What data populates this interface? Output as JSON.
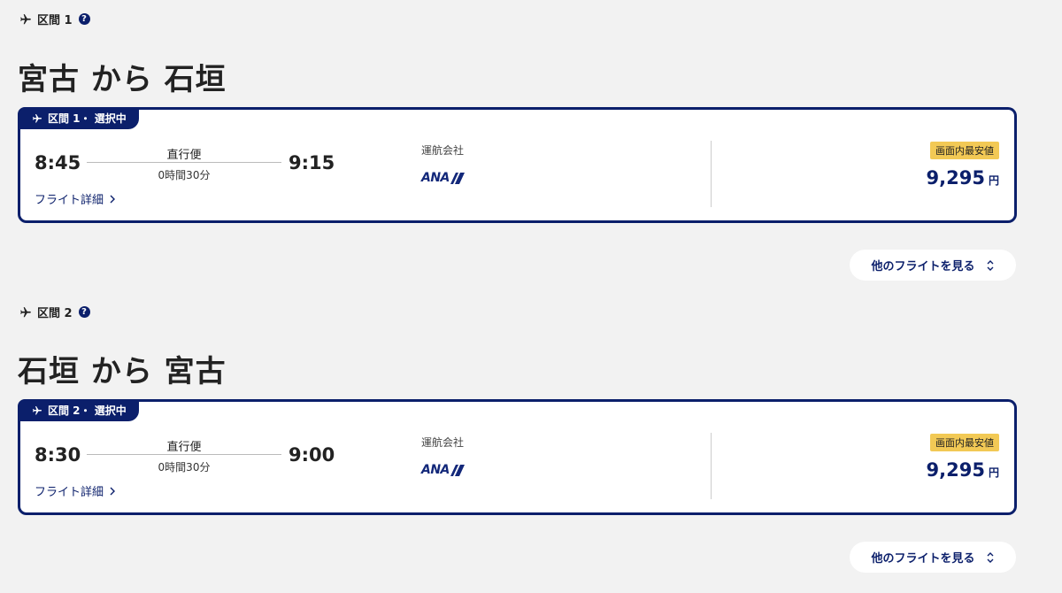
{
  "segments": [
    {
      "label": "区間 1",
      "route_title": "宮古 から 石垣",
      "card": {
        "tab_label": "区間 1・ 選択中",
        "departure_time": "8:45",
        "arrival_time": "9:15",
        "flight_type": "直行便",
        "duration": "0時間30分",
        "details_link": "フライト詳細",
        "operator_label": "運航会社",
        "operator_name": "ANA",
        "badge": "画面内最安値",
        "price": "9,295",
        "currency": "円"
      },
      "more_button": "他のフライトを見る"
    },
    {
      "label": "区間 2",
      "route_title": "石垣 から 宮古",
      "card": {
        "tab_label": "区間 2・ 選択中",
        "departure_time": "8:30",
        "arrival_time": "9:00",
        "flight_type": "直行便",
        "duration": "0時間30分",
        "details_link": "フライト詳細",
        "operator_label": "運航会社",
        "operator_name": "ANA",
        "badge": "画面内最安値",
        "price": "9,295",
        "currency": "円"
      },
      "more_button": "他のフライトを見る"
    }
  ],
  "icons": {
    "plane": "plane-icon",
    "help": "help-icon",
    "chevron_right": "chevron-right-icon",
    "up_down": "chevron-up-down-icon"
  },
  "colors": {
    "primary": "#0b1f6b",
    "badge": "#f2c955",
    "background": "#f2f2f2"
  }
}
